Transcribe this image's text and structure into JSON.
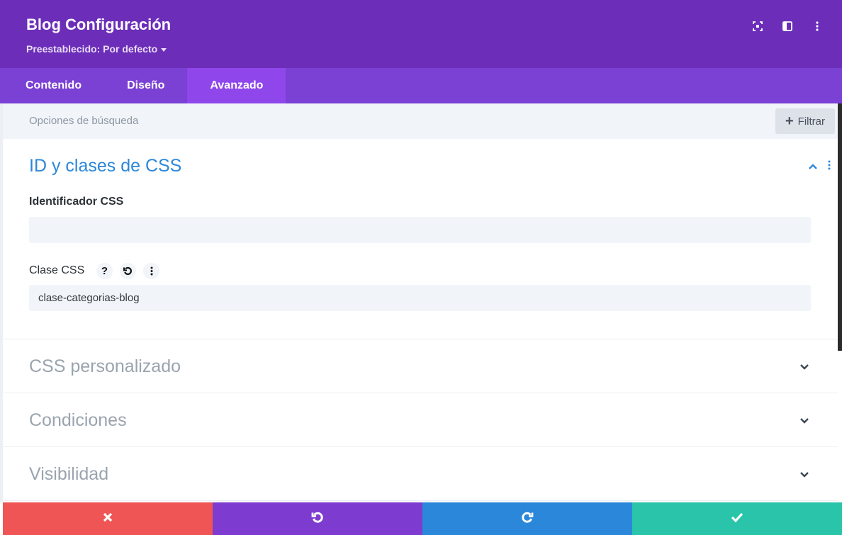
{
  "header": {
    "title": "Blog Configuración",
    "preset": "Preestablecido: Por defecto",
    "icons": [
      "fullscreen-icon",
      "split-view-icon",
      "more-options-icon"
    ],
    "bg_color": "#6c2eb9"
  },
  "tabs": [
    {
      "label": "Contenido",
      "active": false
    },
    {
      "label": "Diseño",
      "active": false
    },
    {
      "label": "Avanzado",
      "active": true
    }
  ],
  "search": {
    "placeholder": "Opciones de búsqueda",
    "filter_label": "Filtrar"
  },
  "sections": {
    "css_ids": {
      "title": "ID y clases de CSS",
      "expanded": true,
      "css_id_label": "Identificador CSS",
      "css_id_value": "",
      "css_class_label": "Clase CSS",
      "css_class_value": "clase-categorias-blog",
      "tool_icons": [
        "help-icon",
        "reset-icon",
        "more-icon"
      ]
    },
    "custom_css": {
      "title": "CSS personalizado",
      "expanded": false
    },
    "conditions": {
      "title": "Condiciones",
      "expanded": false
    },
    "visibility": {
      "title": "Visibilidad",
      "expanded": false
    }
  },
  "footer": {
    "buttons": [
      {
        "name": "cancel",
        "icon": "close-icon",
        "color": "#ef5555"
      },
      {
        "name": "undo",
        "icon": "undo-icon",
        "color": "#7e3bd0"
      },
      {
        "name": "redo",
        "icon": "redo-icon",
        "color": "#2b87da"
      },
      {
        "name": "save",
        "icon": "check-icon",
        "color": "#29c4a9"
      }
    ]
  },
  "colors": {
    "accent_blue": "#2b87da",
    "tab_bar": "#7b40d4",
    "tab_active": "#8f47ec"
  }
}
